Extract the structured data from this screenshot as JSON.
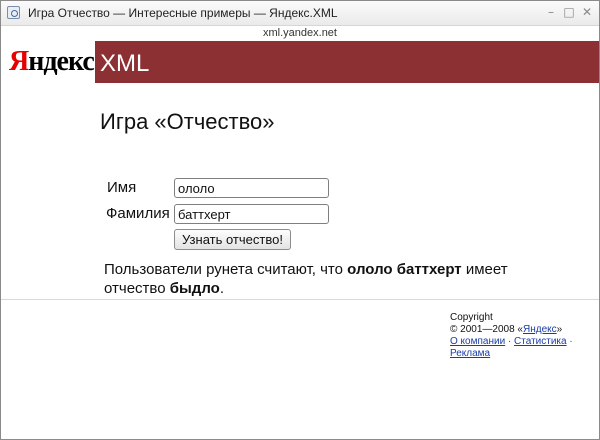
{
  "window": {
    "title": "Игра Отчество — Интересные примеры — Яндекс.XML",
    "minimize_glyph": "–",
    "maximize_glyph": "□",
    "close_glyph": "✕"
  },
  "address": {
    "url": "xml.yandex.net"
  },
  "header": {
    "logo_first_letter": "Я",
    "logo_rest": "ндекс",
    "product": "XML",
    "accent_color": "#8d3034",
    "logo_red": "#e60000"
  },
  "page": {
    "title": "Игра «Отчество»"
  },
  "form": {
    "name_label": "Имя",
    "name_value": "ололо",
    "surname_label": "Фамилия",
    "surname_value": "баттхерт",
    "submit_label": "Узнать отчество!"
  },
  "result": {
    "prefix": "Пользователи рунета считают, что ",
    "full_name": "ололо баттхерт",
    "middle": " имеет отчество ",
    "patronymic": "быдло",
    "suffix": "."
  },
  "footer": {
    "copyright_label": "Copyright",
    "copyright_years": "© 2001—2008 «",
    "yandex_link": "Яндекс",
    "copyright_close": "»",
    "about_link": "О компании",
    "separator": " · ",
    "stats_link": "Статистика",
    "separator_end": " ·",
    "ads_link": "Реклама"
  }
}
